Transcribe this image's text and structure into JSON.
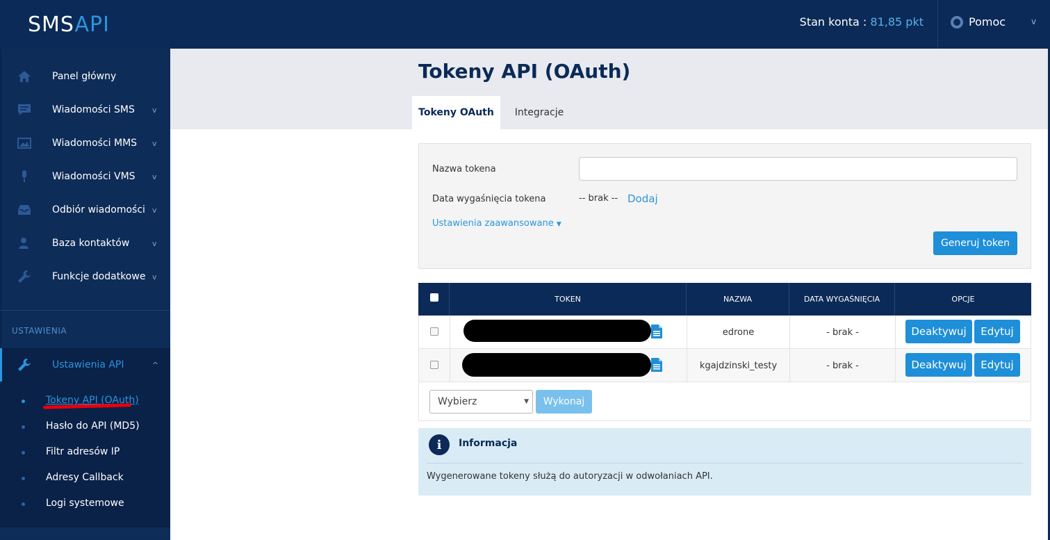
{
  "app": {
    "logo_sms": "SMS",
    "logo_api": "API",
    "balance_label": "Stan konta :",
    "balance_value": "81,85 pkt",
    "help_label": "Pomoc"
  },
  "sidebar": {
    "items": [
      {
        "label": "Panel główny",
        "icon": "home-icon"
      },
      {
        "label": "Wiadomości SMS",
        "icon": "message-icon"
      },
      {
        "label": "Wiadomości MMS",
        "icon": "image-icon"
      },
      {
        "label": "Wiadomości VMS",
        "icon": "microphone-icon"
      },
      {
        "label": "Odbiór wiadomości",
        "icon": "inbox-icon"
      },
      {
        "label": "Baza kontaktów",
        "icon": "contacts-icon"
      },
      {
        "label": "Funkcje dodatkowe",
        "icon": "wrench-icon"
      }
    ],
    "section_label": "USTAWIENIA",
    "api_settings_label": "Ustawienia API",
    "sub_items": [
      {
        "label": "Tokeny API (OAuth)",
        "active": true
      },
      {
        "label": "Hasło do API (MD5)",
        "active": false
      },
      {
        "label": "Filtr adresów IP",
        "active": false
      },
      {
        "label": "Adresy Callback",
        "active": false
      },
      {
        "label": "Logi systemowe",
        "active": false
      }
    ]
  },
  "page": {
    "title": "Tokeny API (OAuth)",
    "tabs": [
      {
        "label": "Tokeny OAuth",
        "active": true
      },
      {
        "label": "Integracje",
        "active": false
      }
    ]
  },
  "form": {
    "token_name_label": "Nazwa tokena",
    "token_name_value": "",
    "expiry_label": "Data wygaśnięcia tokena",
    "expiry_value": "-- brak --",
    "add_link": "Dodaj",
    "advanced_link": "Ustawienia zaawansowane",
    "generate_button": "Generuj token"
  },
  "table": {
    "headers": [
      "TOKEN",
      "NAZWA",
      "DATA WYGAŚNIĘCIA",
      "OPCJE"
    ],
    "rows": [
      {
        "name": "edrone",
        "expiry": "- brak -",
        "deactivate": "Deaktywuj",
        "edit": "Edytuj"
      },
      {
        "name": "kgajdzinski_testy",
        "expiry": "- brak -",
        "deactivate": "Deaktywuj",
        "edit": "Edytuj"
      }
    ],
    "bulk_select_value": "Wybierz",
    "bulk_execute": "Wykonaj"
  },
  "info": {
    "icon_glyph": "i",
    "title": "Informacja",
    "text": "Wygenerowane tokeny służą do autoryzacji w odwołaniach API."
  },
  "colors": {
    "navy": "#0b2a57",
    "accent": "#2b95dd",
    "button": "#1e8fd8",
    "info_bg": "#d9ebf5",
    "highlight_underline": "#e8000b"
  }
}
